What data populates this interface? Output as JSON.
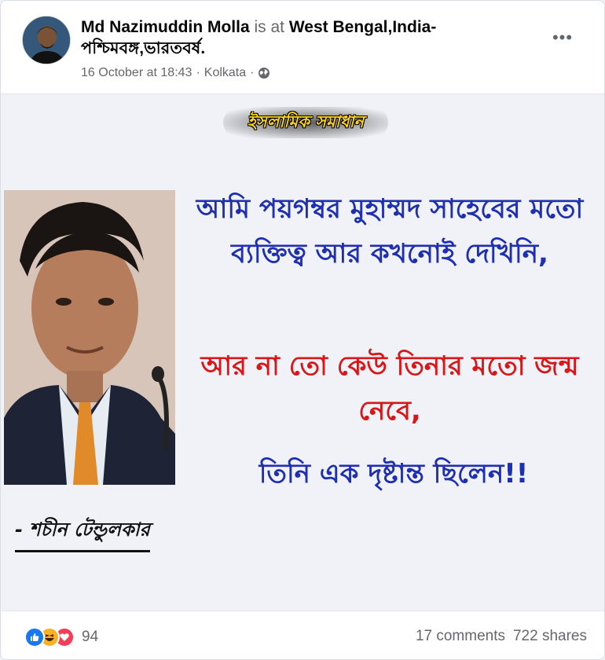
{
  "post": {
    "author": "Md Nazimuddin Molla",
    "is_at": "is at",
    "place": "West Bengal,India-পশ্চিমবঙ্গ,ভারতবর্ষ.",
    "timestamp": "16 October at 18:43",
    "separator": "·",
    "location": "Kolkata",
    "more_label": "•••"
  },
  "image": {
    "banner": "ইসলামিক সমাধান",
    "quote_blue": "আমি পয়গম্বর মুহাম্মদ সাহেবের মতো ব্যক্তিত্ব আর কখনোই দেখিনি,",
    "quote_red": "আর না তো কেউ তিনার মতো জন্ম নেবে,",
    "quote_blue2": "তিনি এক দৃষ্টান্ত ছিলেন!!",
    "signature": "- শচীন টেন্ডুলকার"
  },
  "footer": {
    "reaction_count": "94",
    "comments": "17 comments",
    "shares": "722 shares",
    "reaction_icons": [
      "like-icon",
      "haha-icon",
      "love-icon"
    ]
  },
  "colors": {
    "quote_blue": "#1e2fb0",
    "quote_red": "#d61818",
    "banner_yellow": "#ffd21a",
    "like_blue": "#1877f2",
    "love_red": "#f33e58",
    "haha_yellow": "#f7b125"
  }
}
